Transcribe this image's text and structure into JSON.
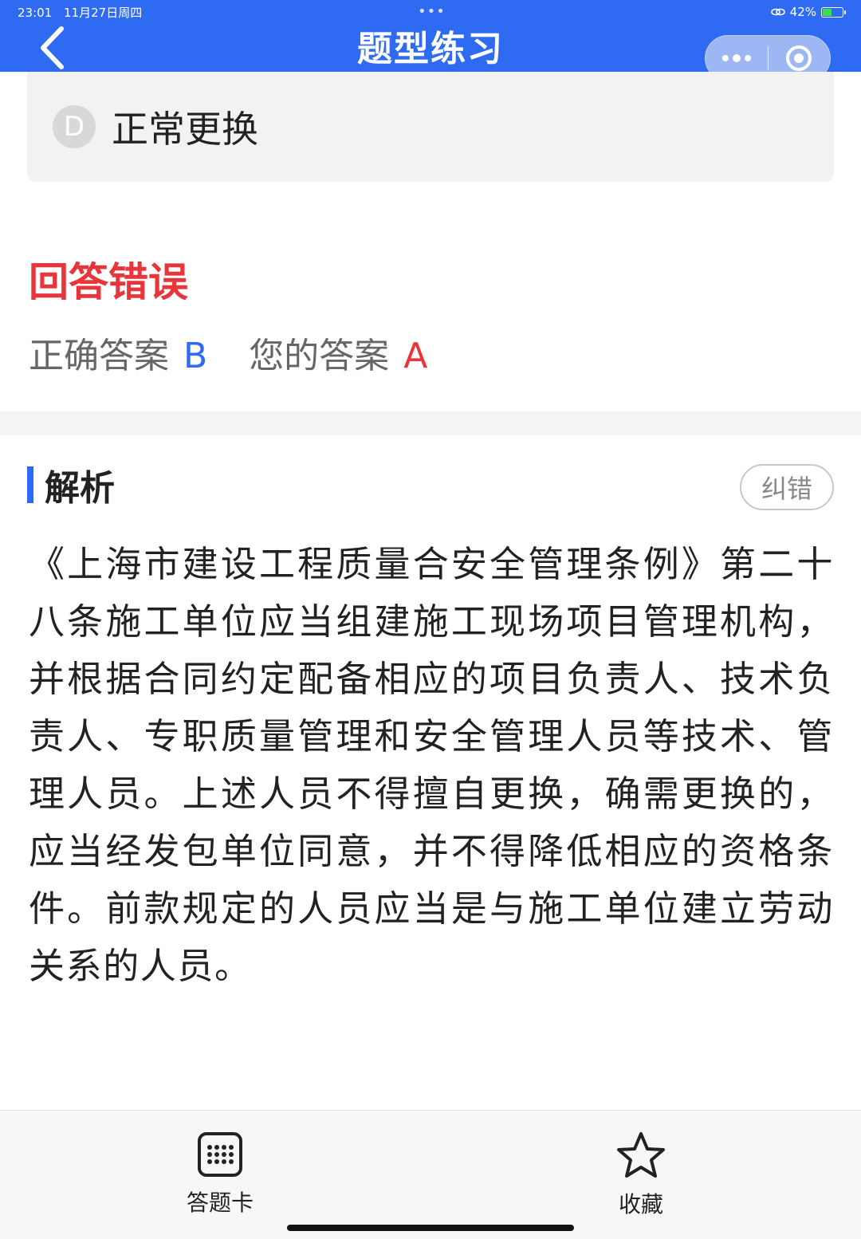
{
  "status_bar": {
    "time": "23:01",
    "date": "11月27日周四",
    "battery": "42%"
  },
  "header": {
    "title": "题型练习"
  },
  "option": {
    "letter": "D",
    "text": "正常更换"
  },
  "result": {
    "title": "回答错误",
    "correct_label": "正确答案",
    "correct_value": "B",
    "yours_label": "您的答案",
    "yours_value": "A"
  },
  "analysis": {
    "title": "解析",
    "report_button": "纠错",
    "text": "《上海市建设工程质量合安全管理条例》第二十八条施工单位应当组建施工现场项目管理机构，并根据合同约定配备相应的项目负责人、技术负责人、专职质量管理和安全管理人员等技术、管理人员。上述人员不得擅自更换，确需更换的，应当经发包单位同意，并不得降低相应的资格条件。前款规定的人员应当是与施工单位建立劳动关系的人员。"
  },
  "bottom_bar": {
    "card_label": "答题卡",
    "favorite_label": "收藏"
  },
  "colors": {
    "header": "#2F6BF2",
    "error": "#e8353a",
    "accent": "#2F6BF2"
  },
  "icons": {
    "back": "chevron-left-icon",
    "more": "more-dots-icon",
    "close": "target-circle-icon",
    "card": "grid-icon",
    "favorite": "star-icon"
  }
}
